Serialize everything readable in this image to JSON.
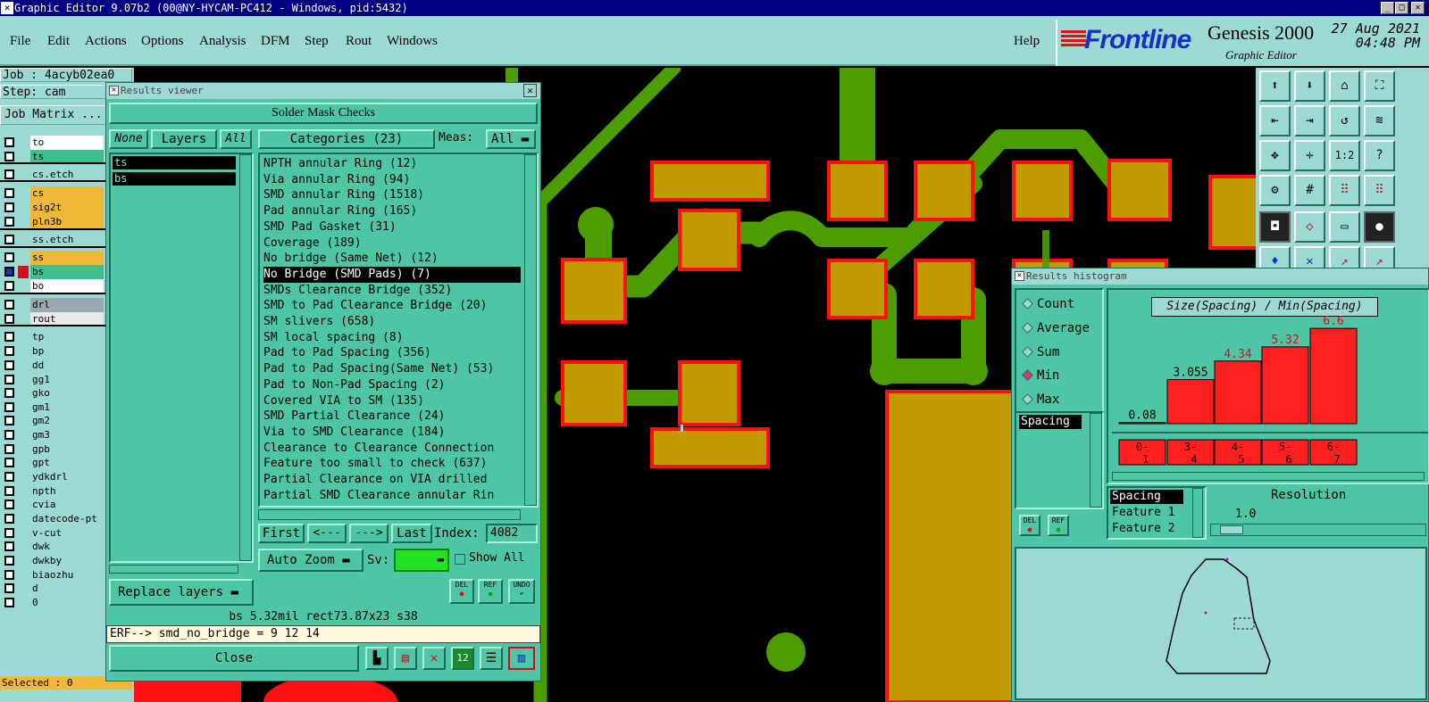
{
  "window": {
    "title": "Graphic Editor 9.07b2 (00@NY-HYCAM-PC412 - Windows, pid:5432)"
  },
  "menu": [
    "File",
    "Edit",
    "Actions",
    "Options",
    "Analysis",
    "DFM",
    "Step",
    "Rout",
    "Windows"
  ],
  "help": "Help",
  "brand": {
    "company": "Frontline",
    "product": "Genesis 2000",
    "subtitle": "Graphic Editor",
    "date": "27 Aug 2021",
    "time": "04:48 PM"
  },
  "left": {
    "job": "Job : 4acyb02ea0",
    "step": "Step: cam",
    "matrix": "Job Matrix ...",
    "selected": "Selected : 0"
  },
  "layers": [
    {
      "name": "to",
      "color": "#ffffff"
    },
    {
      "name": "ts",
      "color": "#3fbf8f"
    },
    {
      "name": "cs.etch",
      "color": "#9dd9d3"
    },
    {
      "name": "cs",
      "color": "#f0b838"
    },
    {
      "name": "sig2t",
      "color": "#f0b838"
    },
    {
      "name": "pln3b",
      "color": "#f0b838"
    },
    {
      "name": "ss.etch",
      "color": "#9dd9d3"
    },
    {
      "name": "ss",
      "color": "#f0b838"
    },
    {
      "name": "bs",
      "color": "#3fbf8f"
    },
    {
      "name": "bo",
      "color": "#ffffff"
    },
    {
      "name": "drl",
      "color": "#9aa8b0"
    },
    {
      "name": "rout",
      "color": "#e8e8e8"
    },
    {
      "name": "tp",
      "color": "#9dd9d3"
    },
    {
      "name": "bp",
      "color": "#9dd9d3"
    },
    {
      "name": "dd",
      "color": "#9dd9d3"
    },
    {
      "name": "gg1",
      "color": "#9dd9d3"
    },
    {
      "name": "gko",
      "color": "#9dd9d3"
    },
    {
      "name": "gm1",
      "color": "#9dd9d3"
    },
    {
      "name": "gm2",
      "color": "#9dd9d3"
    },
    {
      "name": "gm3",
      "color": "#9dd9d3"
    },
    {
      "name": "gpb",
      "color": "#9dd9d3"
    },
    {
      "name": "gpt",
      "color": "#9dd9d3"
    },
    {
      "name": "ydkdrl",
      "color": "#9dd9d3"
    },
    {
      "name": "npth",
      "color": "#9dd9d3"
    },
    {
      "name": "cvia",
      "color": "#9dd9d3"
    },
    {
      "name": "datecode-pt",
      "color": "#9dd9d3"
    },
    {
      "name": "v-cut",
      "color": "#9dd9d3"
    },
    {
      "name": "dwk",
      "color": "#9dd9d3"
    },
    {
      "name": "dwkby",
      "color": "#9dd9d3"
    },
    {
      "name": "biaozhu",
      "color": "#9dd9d3"
    },
    {
      "name": "d",
      "color": "#9dd9d3"
    },
    {
      "name": "0",
      "color": "#9dd9d3"
    }
  ],
  "results": {
    "title": "Results viewer",
    "header": "Solder Mask Checks",
    "none": "None",
    "layers_label": "Layers",
    "all": "All",
    "layer_list": [
      "ts",
      "bs"
    ],
    "categories_label": "Categories (23)",
    "meas_label": "Meas:",
    "meas_value": "All",
    "categories": [
      "NPTH annular Ring (12)",
      "Via annular Ring (94)",
      "SMD annular Ring (1518)",
      "Pad annular Ring (165)",
      "SMD Pad Gasket (31)",
      "Coverage (189)",
      "No bridge (Same Net) (12)",
      "No Bridge (SMD Pads) (7)",
      "SMDs Clearance Bridge (352)",
      "SMD to Pad Clearance Bridge (20)",
      "SM slivers (658)",
      "SM local spacing (8)",
      "Pad to Pad Spacing (356)",
      "Pad to Pad Spacing(Same Net) (53)",
      "Pad to Non-Pad Spacing (2)",
      "Covered VIA to SM (135)",
      "SMD Partial Clearance (24)",
      "Via to SMD Clearance (184)",
      "Clearance to Clearance Connection",
      "Feature too small to check (637)",
      "Partial Clearance on VIA drilled",
      "Partial SMD Clearance annular Rin"
    ],
    "first": "First",
    "prev": "<---",
    "next": "--->",
    "last": "Last",
    "index_label": "Index:",
    "index_value": "4082",
    "auto_zoom": "Auto Zoom",
    "sv": "Sv:",
    "show_all": "Show All",
    "replace_layers": "Replace layers",
    "del": "DEL",
    "ref": "REF",
    "undo": "UNDO",
    "info": "bs 5.32mil   rect73.87x23   s38",
    "erf": "ERF--> smd_no_bridge = 9 12 14",
    "close": "Close"
  },
  "histogram": {
    "title": "Results histogram",
    "stat_options": [
      "Count",
      "Average",
      "Sum",
      "Min",
      "Max"
    ],
    "selected_stat": "Min",
    "list_item": "Spacing",
    "chart_title": "Size(Spacing) / Min(Spacing)",
    "feature_list": [
      "Spacing",
      "Feature 1",
      "Feature 2"
    ],
    "resolution_label": "Resolution",
    "resolution_value": "1.0",
    "del": "DEL",
    "ref": "REF"
  },
  "chart_data": {
    "type": "bar",
    "title": "Size(Spacing) / Min(Spacing)",
    "categories": [
      "0-1",
      "3-4",
      "4-5",
      "5-6",
      "6-7"
    ],
    "values": [
      0.08,
      3.055,
      4.34,
      5.32,
      6.6
    ],
    "value_labels": [
      "0.08",
      "3.055",
      "4.34",
      "5.32",
      "6.6"
    ],
    "ylim": [
      0,
      7
    ],
    "bar_color": "#ff1f1f"
  },
  "colors": {
    "panel": "#4ec6a6",
    "menu": "#9dd9d3",
    "copper": "#c19a00",
    "trace": "#4c9e00",
    "outline": "#ff1010"
  }
}
